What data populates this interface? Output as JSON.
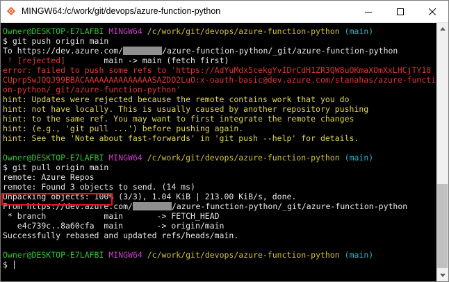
{
  "window": {
    "title": "MINGW64:/c/work/git/devops/azure-function-python"
  },
  "colors": {
    "prompt_user": "#2fc62f",
    "prompt_system": "#c93cc9",
    "prompt_path": "#d2c22a",
    "prompt_branch": "#28b8c8",
    "error": "#e03535",
    "hint": "#e2d64e",
    "highlight_border": "#e8141c"
  },
  "terminal": {
    "prompt1": {
      "user": "Owner@DESKTOP-E7LAFBI",
      "system": "MINGW64",
      "path": "/c/work/git/devops/azure-function-python",
      "branch": "(main)"
    },
    "cmd1": "$ git push origin main",
    "push_to_prefix": "To https://dev.azure.com/",
    "push_to_suffix": "/azure-function-python/_git/azure-function-python",
    "rejected_tag": " ! [rejected]",
    "rejected_rest": "        main -> main (fetch first)",
    "error_lines": [
      "error: failed to push some refs to 'https://AdYuMdx5cekgYvIDrCdH1ZR3QW8uOKmaXOmXxLHCjTY18",
      "CUprpSwJQQJ99BBACAAAAAAAAAAAAAASAZDO2LuO:x-oauth-basic@dev.azure.com/stanahas/azure-functi",
      "on-python/_git/azure-function-python'"
    ],
    "hint_lines": [
      "hint: Updates were rejected because the remote contains work that you do",
      "hint: not have locally. This is usually caused by another repository pushing",
      "hint: to the same ref. You may want to first integrate the remote changes",
      "hint: (e.g., 'git pull ...') before pushing again.",
      "hint: See the 'Note about fast-forwards' in 'git push --help' for details."
    ],
    "prompt2": {
      "user": "Owner@DESKTOP-E7LAFBI",
      "system": "MINGW64",
      "path": "/c/work/git/devops/azure-function-python",
      "branch": "(main)"
    },
    "cmd2": "$ git pull origin main",
    "pull_lines_a": [
      "remote: Azure Repos",
      "remote: Found 3 objects to send. (14 ms)",
      "Unpacking objects: 100% (3/3), 1.04 KiB | 213.00 KiB/s, done."
    ],
    "from_prefix": "From https://dev.azure.com/",
    "from_suffix": "/azure-function-python/_git/azure-function-python",
    "pull_lines_b": [
      " * branch            main       -> FETCH_HEAD",
      "   e4c739c..8a60cfa  main       -> origin/main",
      "Successfully rebased and updated refs/heads/main."
    ],
    "prompt3": {
      "user": "Owner@DESKTOP-E7LAFBI",
      "system": "MINGW64",
      "path": "/c/work/git/devops/azure-function-python",
      "branch": "(main)"
    },
    "cmd3": "$ "
  }
}
